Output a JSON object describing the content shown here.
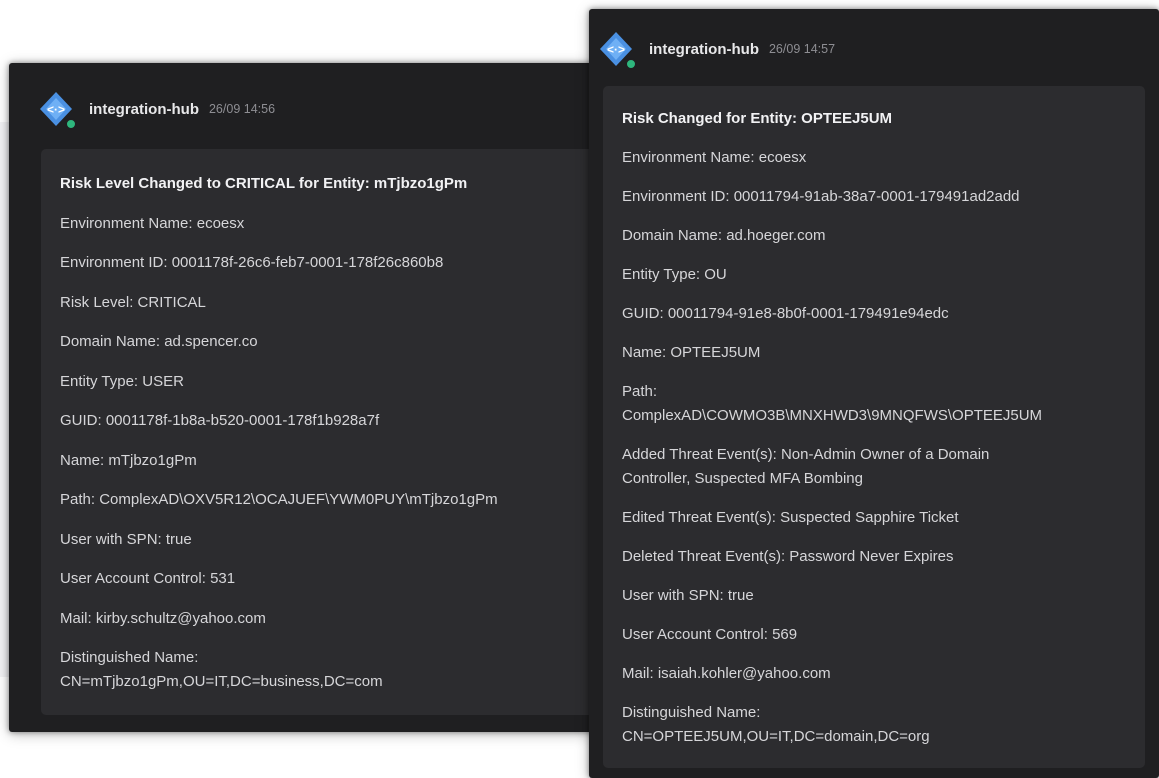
{
  "colors": {
    "window_bg": "#1f1f21",
    "card_bg": "#2c2c2f",
    "text": "#d6d6d9",
    "muted": "#8e8e93",
    "app_icon": "#4a90e2",
    "online": "#2eb67d"
  },
  "messages": [
    {
      "sender": "integration-hub",
      "timestamp": "26/09 14:56",
      "icon": "integration-hub-app-icon",
      "lines": [
        "Risk Level Changed to CRITICAL for Entity: mTjbzo1gPm",
        "Environment Name: ecoesx",
        "Environment ID: 0001178f-26c6-feb7-0001-178f26c860b8",
        "Risk Level: CRITICAL",
        "Domain Name: ad.spencer.co",
        "Entity Type: USER",
        "GUID: 0001178f-1b8a-b520-0001-178f1b928a7f",
        "Name: mTjbzo1gPm",
        "Path: ComplexAD\\OXV5R12\\OCAJUEF\\YWM0PUY\\mTjbzo1gPm",
        "User with SPN: true",
        "User Account Control: 531",
        "Mail: kirby.schultz@yahoo.com",
        "Distinguished Name:\nCN=mTjbzo1gPm,OU=IT,DC=business,DC=com"
      ]
    },
    {
      "sender": "integration-hub",
      "timestamp": "26/09 14:57",
      "icon": "integration-hub-app-icon",
      "lines": [
        "Risk Changed for Entity: OPTEEJ5UM",
        "Environment Name: ecoesx",
        "Environment ID: 00011794-91ab-38a7-0001-179491ad2add",
        "Domain Name: ad.hoeger.com",
        "Entity Type: OU",
        "GUID: 00011794-91e8-8b0f-0001-179491e94edc",
        "Name: OPTEEJ5UM",
        "Path:\nComplexAD\\COWMO3B\\MNXHWD3\\9MNQFWS\\OPTEEJ5UM",
        "Added Threat Event(s): Non-Admin Owner of a Domain\nController, Suspected MFA Bombing",
        "Edited Threat Event(s): Suspected Sapphire Ticket",
        "Deleted Threat Event(s): Password Never Expires",
        "User with SPN: true",
        "User Account Control: 569",
        "Mail: isaiah.kohler@yahoo.com",
        "Distinguished Name:\nCN=OPTEEJ5UM,OU=IT,DC=domain,DC=org"
      ]
    }
  ]
}
